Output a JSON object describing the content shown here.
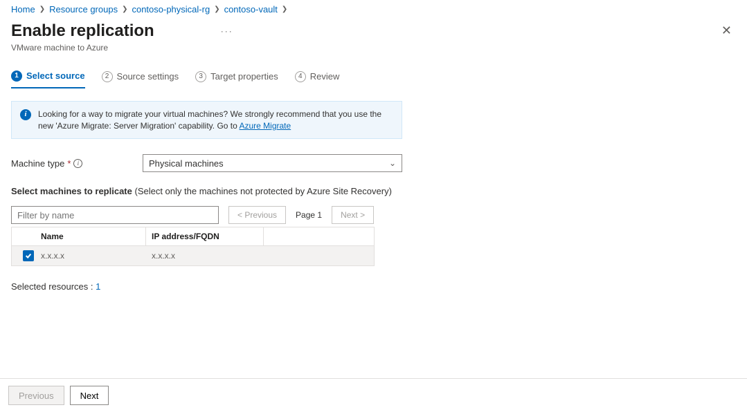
{
  "breadcrumb": [
    {
      "label": "Home"
    },
    {
      "label": "Resource groups"
    },
    {
      "label": "contoso-physical-rg"
    },
    {
      "label": "contoso-vault"
    }
  ],
  "header": {
    "title": "Enable replication",
    "subtitle": "VMware machine to Azure"
  },
  "tabs": [
    {
      "num": "1",
      "label": "Select source",
      "active": true
    },
    {
      "num": "2",
      "label": "Source settings"
    },
    {
      "num": "3",
      "label": "Target properties"
    },
    {
      "num": "4",
      "label": "Review"
    }
  ],
  "info": {
    "text": "Looking for a way to migrate your virtual machines? We strongly recommend that you use the new 'Azure Migrate: Server Migration' capability. Go to ",
    "link": "Azure Migrate"
  },
  "field": {
    "label": "Machine type",
    "value": "Physical machines"
  },
  "section": {
    "label": "Select machines to replicate",
    "hint": "(Select only the machines not protected by Azure Site Recovery)"
  },
  "filter": {
    "placeholder": "Filter by name"
  },
  "pager": {
    "prev": "<  Previous",
    "page": "Page 1",
    "next": "Next  >"
  },
  "table": {
    "cols": {
      "name": "Name",
      "ip": "IP address/FQDN"
    },
    "rows": [
      {
        "name": "x.x.x.x",
        "ip": "x.x.x.x",
        "checked": true
      }
    ]
  },
  "selected": {
    "label": "Selected resources : ",
    "count": "1"
  },
  "footer": {
    "prev": "Previous",
    "next": "Next"
  }
}
